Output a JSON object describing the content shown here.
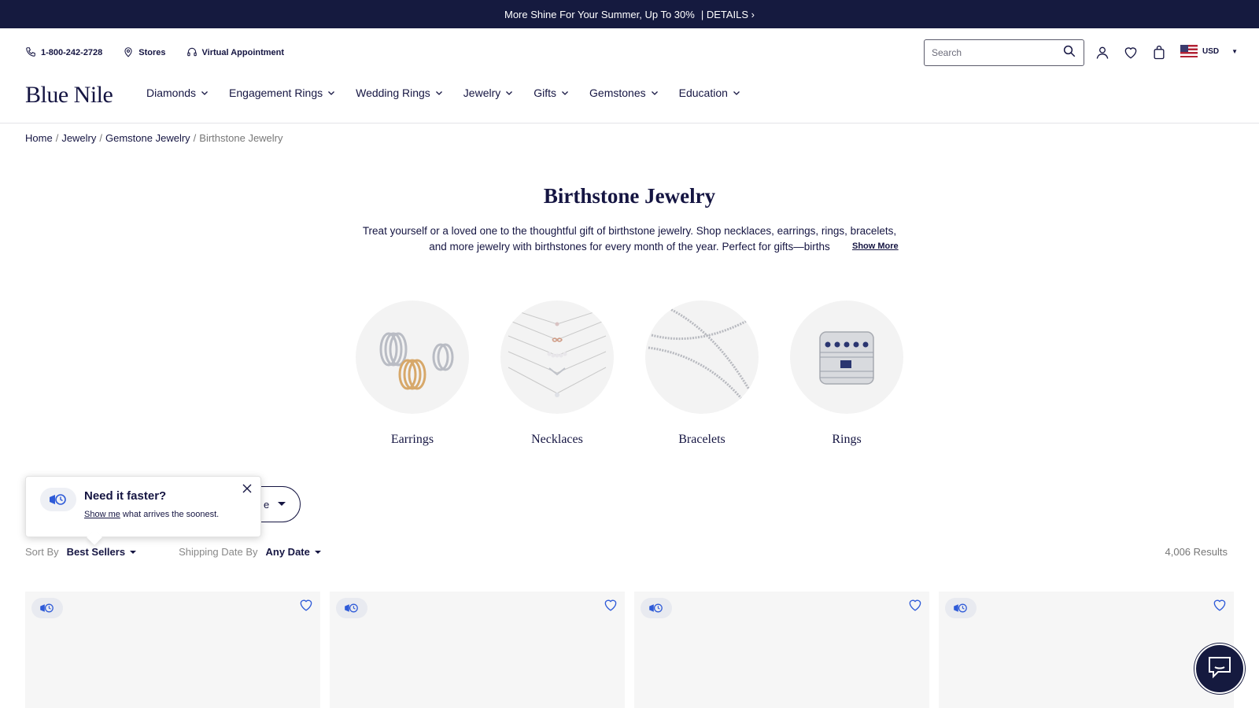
{
  "promo": {
    "text": "More Shine For Your Summer, Up To 30%",
    "details": "| DETAILS ›"
  },
  "utility": {
    "phone": "1-800-242-2728",
    "stores": "Stores",
    "virtual": "Virtual Appointment"
  },
  "search": {
    "placeholder": "Search"
  },
  "currency": {
    "code": "USD"
  },
  "logo": "Blue Nile",
  "nav": [
    "Diamonds",
    "Engagement Rings",
    "Wedding Rings",
    "Jewelry",
    "Gifts",
    "Gemstones",
    "Education"
  ],
  "breadcrumb": {
    "items": [
      "Home",
      "Jewelry",
      "Gemstone Jewelry"
    ],
    "current": "Birthstone Jewelry",
    "sep": "/"
  },
  "hero": {
    "title": "Birthstone Jewelry",
    "desc_1": "Treat yourself or a loved one to the thoughtful gift of birthstone jewelry. Shop necklaces, earrings, rings, bracelets, and more jewelry with birthstones for every month of the year. Perfect for gifts—births",
    "desc_fade": "",
    "show_more": "Show More"
  },
  "categories": [
    "Earrings",
    "Necklaces",
    "Bracelets",
    "Rings"
  ],
  "filter_pill": {
    "label": "e"
  },
  "popover": {
    "title": "Need it faster?",
    "link": "Show me",
    "text": " what arrives the soonest."
  },
  "sort": {
    "sort_label": "Sort By",
    "sort_value": "Best Sellers",
    "ship_label": "Shipping Date By",
    "ship_value": "Any Date"
  },
  "results": "4,006 Results",
  "colors": {
    "navy": "#151a3f",
    "accent_blue": "#2f5bd8"
  }
}
